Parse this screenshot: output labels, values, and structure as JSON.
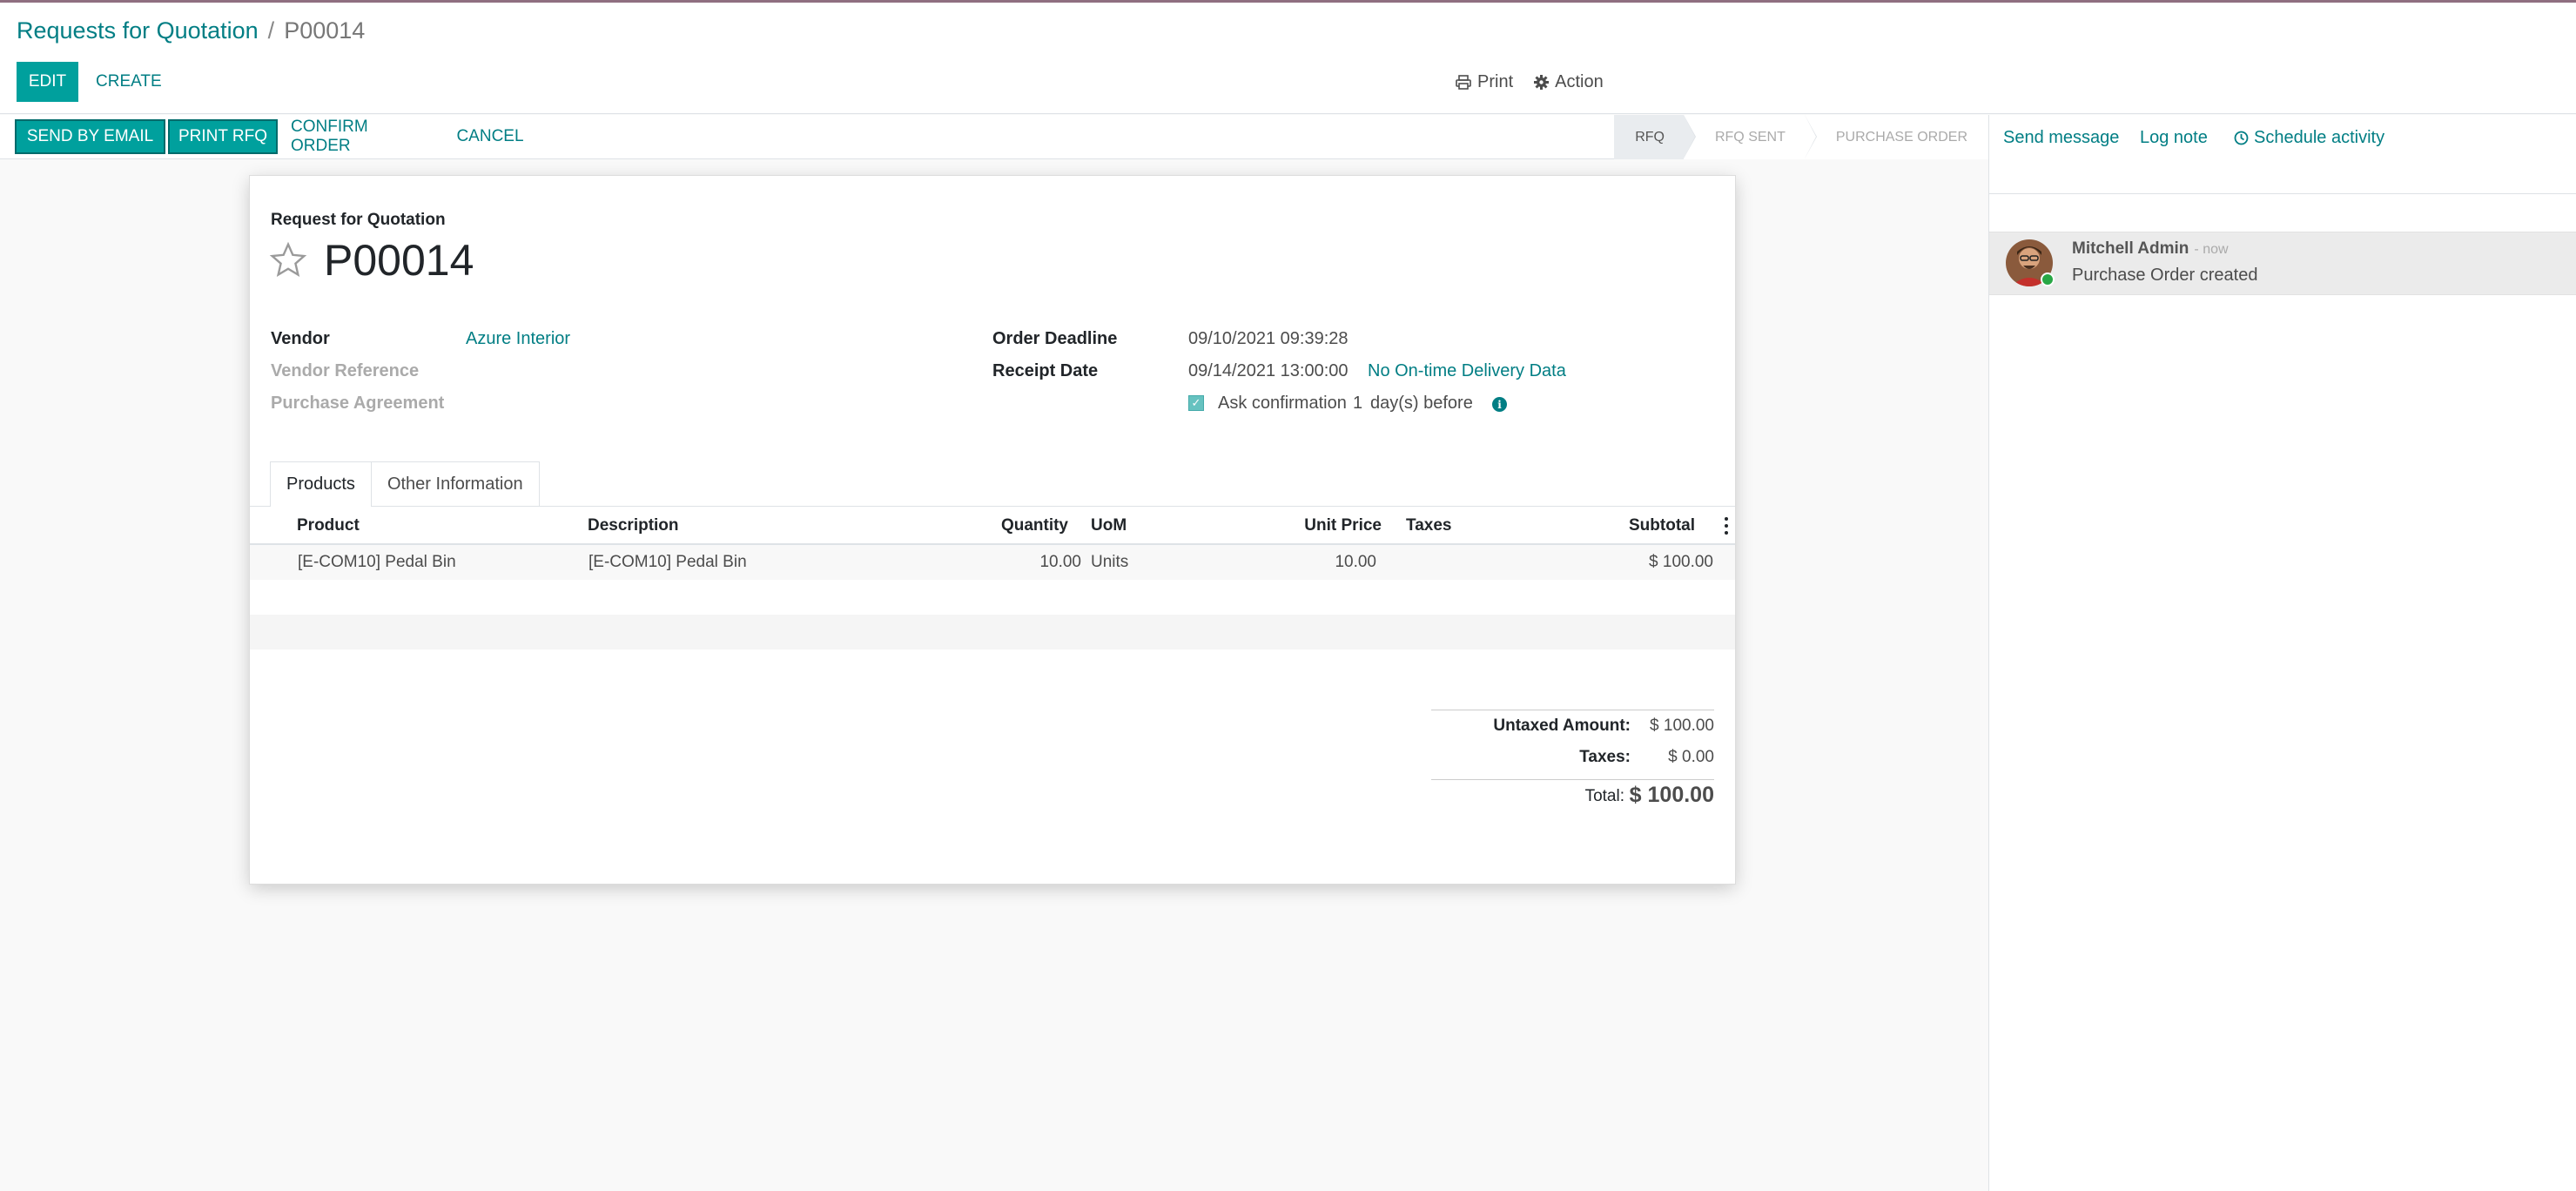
{
  "breadcrumb": {
    "parent": "Requests for Quotation",
    "current": "P00014"
  },
  "control_panel": {
    "edit_label": "EDIT",
    "create_label": "CREATE",
    "print_label": "Print",
    "action_label": "Action"
  },
  "statusbar": {
    "send_email": "SEND BY EMAIL",
    "print_rfq": "PRINT RFQ",
    "confirm": "CONFIRM ORDER",
    "cancel": "CANCEL",
    "stages": [
      "RFQ",
      "RFQ SENT",
      "PURCHASE ORDER"
    ],
    "active_stage": "RFQ"
  },
  "form": {
    "subtitle": "Request for Quotation",
    "name": "P00014",
    "vendor_label": "Vendor",
    "vendor_value": "Azure Interior",
    "vendor_ref_label": "Vendor Reference",
    "agreement_label": "Purchase Agreement",
    "deadline_label": "Order Deadline",
    "deadline_value": "09/10/2021 09:39:28",
    "receipt_label": "Receipt Date",
    "receipt_value": "09/14/2021 13:00:00",
    "delivery_link": "No On-time Delivery Data",
    "confirm_text": "Ask confirmation",
    "confirm_days": "1",
    "confirm_suffix": "day(s) before",
    "ask_confirmation": true
  },
  "tabs": [
    "Products",
    "Other Information"
  ],
  "table": {
    "headers": {
      "product": "Product",
      "description": "Description",
      "quantity": "Quantity",
      "uom": "UoM",
      "unit_price": "Unit Price",
      "taxes": "Taxes",
      "subtotal": "Subtotal"
    },
    "rows": [
      {
        "product": "[E-COM10] Pedal Bin",
        "description": "[E-COM10] Pedal Bin",
        "quantity": "10.00",
        "uom": "Units",
        "unit_price": "10.00",
        "taxes": "",
        "subtotal": "$ 100.00"
      }
    ]
  },
  "totals": {
    "untaxed_label": "Untaxed Amount:",
    "untaxed_value": "$ 100.00",
    "taxes_label": "Taxes:",
    "taxes_value": "$ 0.00",
    "total_label": "Total:",
    "total_value": "$ 100.00"
  },
  "chatter": {
    "send_message": "Send message",
    "log_note": "Log note",
    "schedule_activity": "Schedule activity",
    "messages": [
      {
        "author": "Mitchell Admin",
        "time": "- now",
        "body": "Purchase Order created"
      }
    ]
  },
  "colors": {
    "accent": "#017e84",
    "primary_button": "#00a09d",
    "online": "#28a745"
  }
}
